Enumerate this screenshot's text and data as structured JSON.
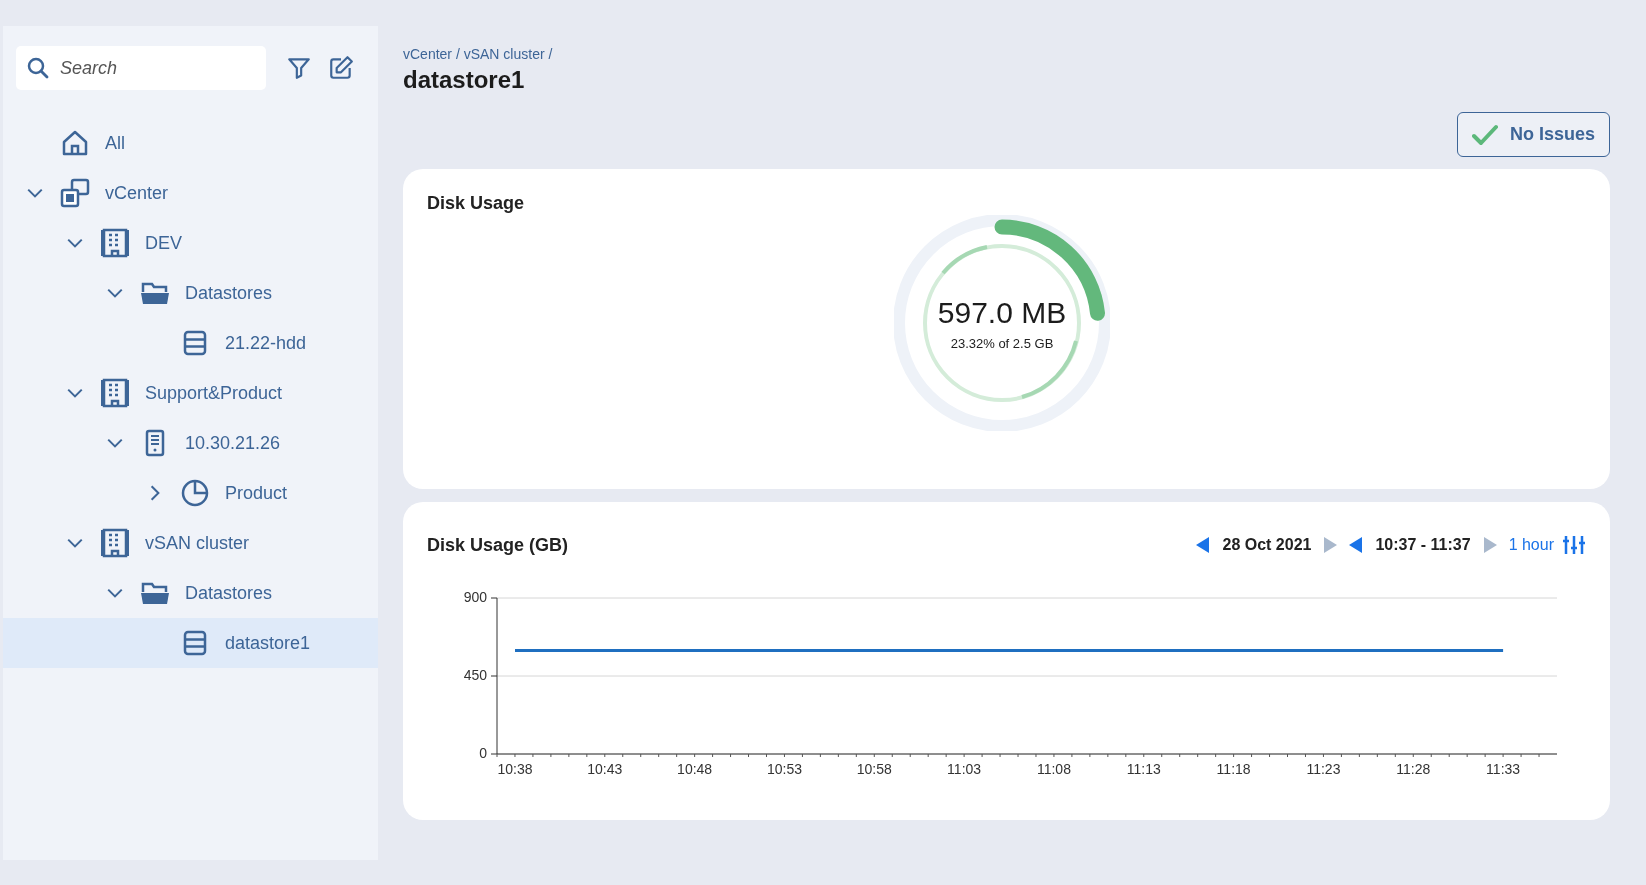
{
  "sidebar": {
    "search": {
      "placeholder": "Search"
    },
    "tree": [
      {
        "label": "All",
        "kind": "home",
        "selected": false
      },
      {
        "label": "vCenter",
        "kind": "vcenter",
        "selected": false,
        "expanded": true,
        "children": [
          {
            "label": "DEV",
            "kind": "datacenter",
            "selected": false,
            "expanded": true,
            "children": [
              {
                "label": "Datastores",
                "kind": "folder",
                "selected": false,
                "expanded": true,
                "children": [
                  {
                    "label": "21.22-hdd",
                    "kind": "datastore",
                    "selected": false
                  }
                ]
              }
            ]
          },
          {
            "label": "Support&Product",
            "kind": "datacenter",
            "selected": false,
            "expanded": true,
            "children": [
              {
                "label": "10.30.21.26",
                "kind": "host",
                "selected": false,
                "expanded": true,
                "children": [
                  {
                    "label": "Product",
                    "kind": "pool",
                    "selected": false,
                    "expanded": false
                  }
                ]
              }
            ]
          },
          {
            "label": "vSAN cluster",
            "kind": "datacenter",
            "selected": false,
            "expanded": true,
            "children": [
              {
                "label": "Datastores",
                "kind": "folder",
                "selected": false,
                "expanded": true,
                "children": [
                  {
                    "label": "datastore1",
                    "kind": "datastore",
                    "selected": true
                  }
                ]
              }
            ]
          }
        ]
      }
    ]
  },
  "breadcrumb": "vCenter / vSAN cluster /",
  "title": "datastore1",
  "status_button": "No Issues",
  "disk_usage": {
    "title": "Disk Usage",
    "value": "597.0 MB",
    "caption": "23.32% of 2.5 GB",
    "level": 0.2332
  },
  "usage_history": {
    "title": "Disk Usage (GB)",
    "date_picker": {
      "value": "28 Oct 2021",
      "next_enabled": false
    },
    "time_range": {
      "value": "10:37 - 11:37",
      "next_enabled": false
    },
    "interval": "1 hour",
    "chart_data": {
      "type": "line",
      "categories": [
        "10:38",
        "10:43",
        "10:48",
        "10:53",
        "10:58",
        "11:03",
        "11:08",
        "11:13",
        "11:18",
        "11:23",
        "11:28",
        "11:33"
      ],
      "series": [
        {
          "color": "#1f6fc0",
          "values": [
            597,
            597,
            597,
            597,
            597,
            597,
            597,
            597,
            597,
            597,
            597,
            597
          ]
        }
      ],
      "ylim": [
        0,
        900
      ],
      "yticks": [
        0,
        450,
        900
      ]
    }
  }
}
